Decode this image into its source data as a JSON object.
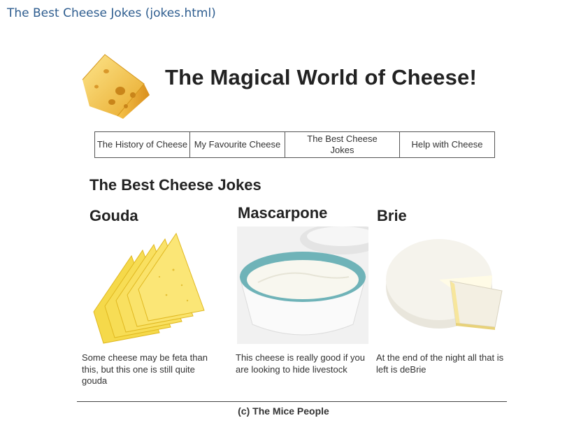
{
  "window": {
    "title": "The Best Cheese Jokes (jokes.html)"
  },
  "site": {
    "title": "The Magical World of Cheese!"
  },
  "nav": {
    "items": [
      {
        "label": "The History of Cheese"
      },
      {
        "label": "My Favourite Cheese"
      },
      {
        "label": "The Best Cheese Jokes"
      },
      {
        "label": "Help with Cheese"
      }
    ]
  },
  "page": {
    "heading": "The Best Cheese Jokes"
  },
  "jokes": [
    {
      "name": "Gouda",
      "caption": "Some cheese may be feta than this, but this one is still quite gouda",
      "icon": "gouda-slices-image"
    },
    {
      "name": "Mascarpone",
      "caption": "This cheese is really good if you are looking to hide livestock",
      "icon": "mascarpone-bowl-image"
    },
    {
      "name": "Brie",
      "caption": "At the end of the night all that is left is deBrie",
      "icon": "brie-wheel-image"
    }
  ],
  "footer": {
    "text": "(c) The Mice People"
  },
  "colors": {
    "title_blue": "#2e5d8f",
    "cheese_yellow": "#f7d64a",
    "mascarpone_bowl": "#6fb3b8"
  }
}
